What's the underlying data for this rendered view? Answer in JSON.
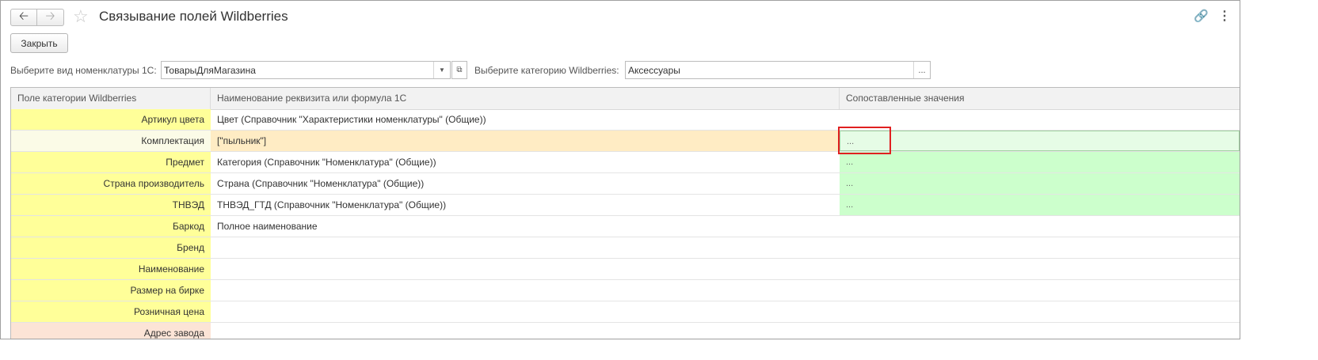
{
  "window": {
    "title": "Связывание полей Wildberries",
    "icons": {
      "back": "arrow-left-icon",
      "forward": "arrow-right-icon",
      "favorite": "star-icon",
      "link": "link-icon",
      "more": "more-vertical-icon"
    }
  },
  "toolbar": {
    "close_label": "Закрыть"
  },
  "filters": {
    "nomenclature_label": "Выберите вид номенклатуры 1С:",
    "nomenclature_value": "ТоварыДляМагазина",
    "category_label": "Выберите категорию Wildberries:",
    "category_value": "Аксессуары",
    "select_button": "..."
  },
  "grid": {
    "columns": [
      "Поле категории Wildberries",
      "Наименование реквизита или формула 1С",
      "Сопоставленные значения"
    ],
    "rows": [
      {
        "field": "Артикул цвета",
        "attribute": "Цвет (Справочник \"Характеристики номенклатуры\" (Общие))",
        "mapped": ""
      },
      {
        "field": "Комплектация",
        "attribute": "[\"пыльник\"]",
        "mapped": "..."
      },
      {
        "field": "Предмет",
        "attribute": "Категория (Справочник \"Номенклатура\" (Общие))",
        "mapped": "..."
      },
      {
        "field": "Страна производитель",
        "attribute": "Страна (Справочник \"Номенклатура\" (Общие))",
        "mapped": "..."
      },
      {
        "field": "ТНВЭД",
        "attribute": "ТНВЭД_ГТД (Справочник \"Номенклатура\" (Общие))",
        "mapped": "..."
      },
      {
        "field": "Баркод",
        "attribute": "Полное наименование",
        "mapped": ""
      },
      {
        "field": "Бренд",
        "attribute": "",
        "mapped": ""
      },
      {
        "field": "Наименование",
        "attribute": "",
        "mapped": ""
      },
      {
        "field": "Размер на бирке",
        "attribute": "",
        "mapped": ""
      },
      {
        "field": "Розничная цена",
        "attribute": "",
        "mapped": ""
      },
      {
        "field": "Адрес завода",
        "attribute": "",
        "mapped": ""
      }
    ]
  },
  "colors": {
    "required_field": "#ffff99",
    "optional_field": "#fce4d6",
    "mapped_values": "#ccffcc",
    "highlight": "#e02020"
  }
}
